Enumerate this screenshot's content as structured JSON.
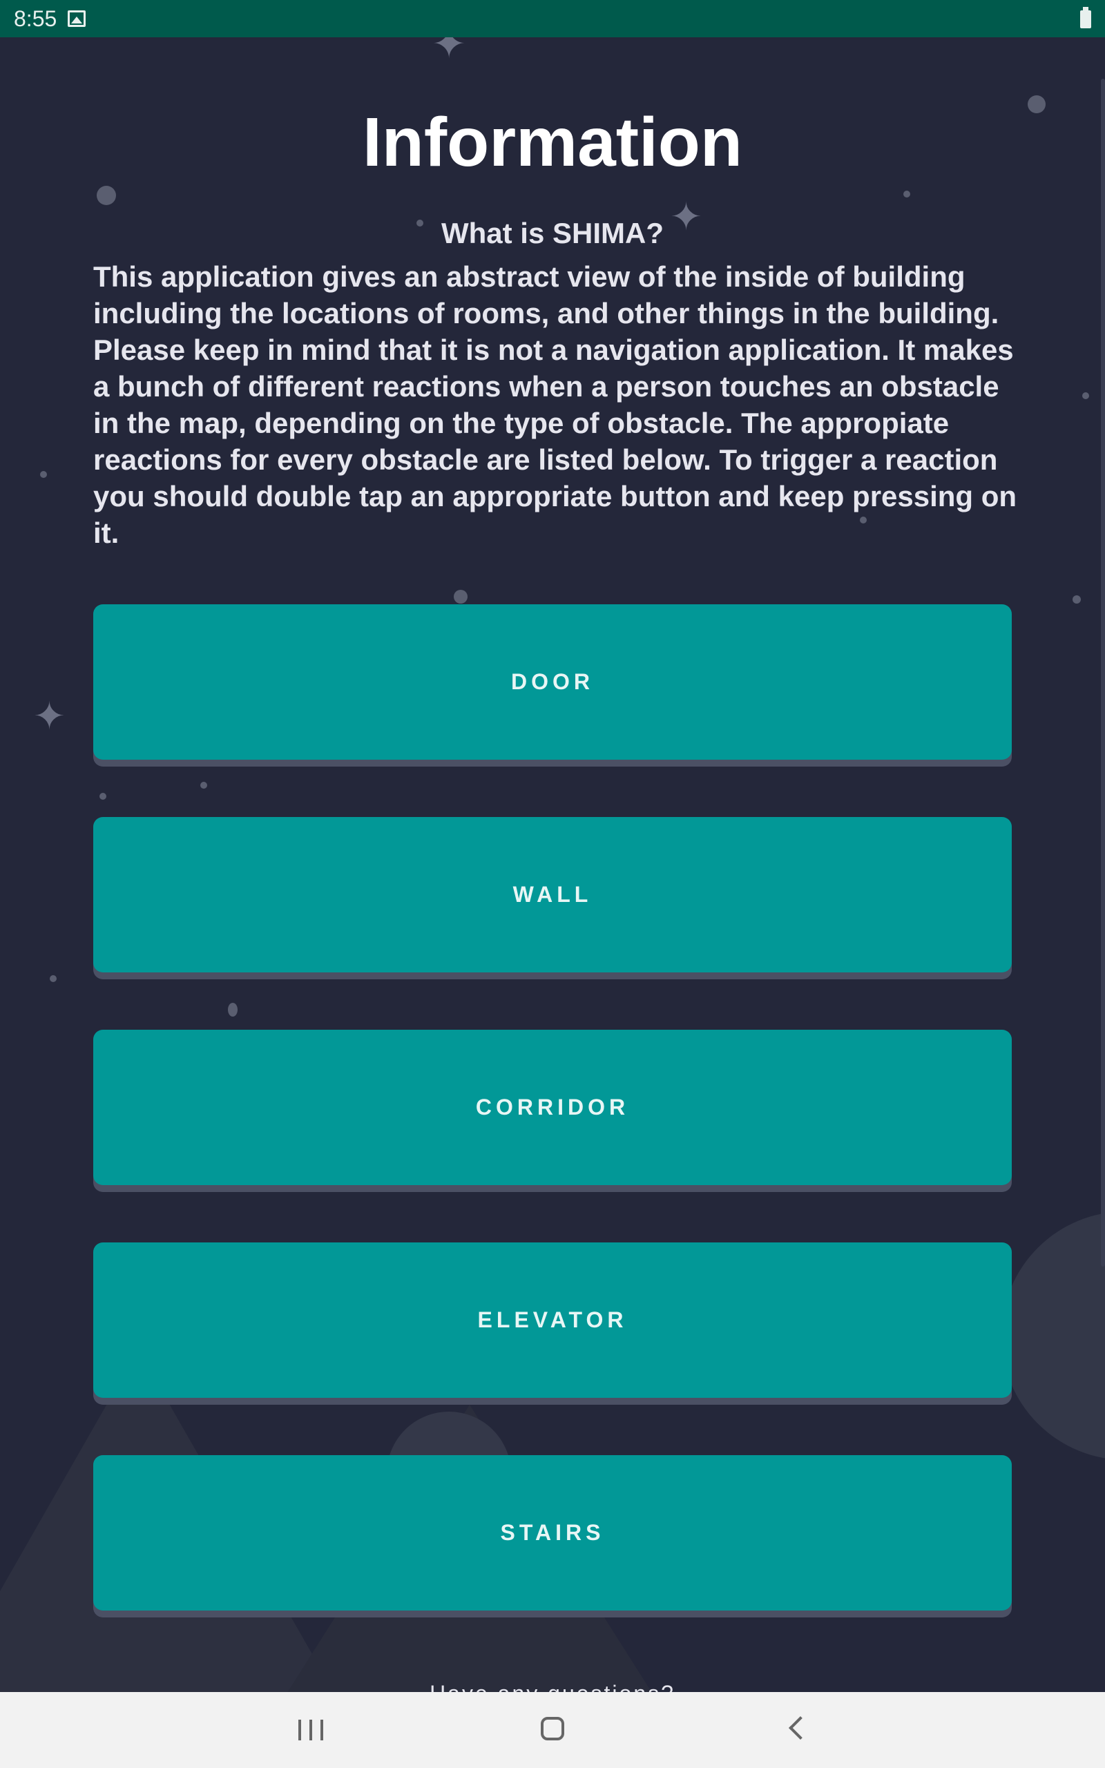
{
  "status_bar": {
    "time": "8:55",
    "icons": [
      "image-icon",
      "battery-icon"
    ]
  },
  "page": {
    "title": "Information",
    "subtitle": "What is SHIMA?",
    "description": "This application gives an abstract view of the inside of building including the locations of rooms, and other things in the building. Please keep in mind that it is not a navigation application. It makes a bunch of different reactions when a person touches an obstacle in the map, depending on the type of obstacle. The appropiate reactions for every obstacle are listed below. To trigger a reaction you should double tap an appropriate button and keep pressing on it.",
    "buttons": [
      "DOOR",
      "WALL",
      "CORRIDOR",
      "ELEVATOR",
      "STAIRS"
    ],
    "footer_text": "Have any questions?"
  },
  "colors": {
    "background": "#24273a",
    "status_bar": "#005a4c",
    "button": "#029897",
    "button_shadow": "#4b5064",
    "nav_bar": "#f2f2f2"
  },
  "nav_bar": {
    "icons": [
      "recent-apps-icon",
      "home-icon",
      "back-icon"
    ]
  }
}
